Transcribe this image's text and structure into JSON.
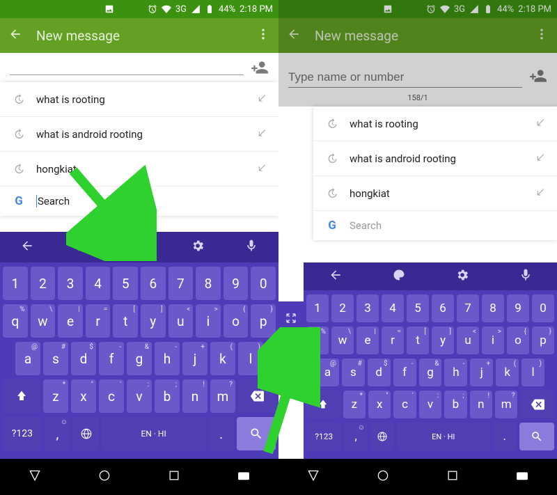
{
  "status": {
    "network": "3G",
    "battery": "44%",
    "time": "2:18 PM"
  },
  "appbar": {
    "title": "New message"
  },
  "recipient": {
    "placeholder": "Type name or number",
    "counter": "158/1"
  },
  "suggestions": [
    {
      "label": "what is rooting"
    },
    {
      "label": "what is android rooting"
    },
    {
      "label": "hongkiat"
    }
  ],
  "searchRow": {
    "label": "Search"
  },
  "keyboard": {
    "row1": [
      "1",
      "2",
      "3",
      "4",
      "5",
      "6",
      "7",
      "8",
      "9",
      "0"
    ],
    "row2": [
      {
        "k": "q",
        "s": "%"
      },
      {
        "k": "w",
        "s": "\\"
      },
      {
        "k": "e",
        "s": "|"
      },
      {
        "k": "r",
        "s": "="
      },
      {
        "k": "t",
        "s": "["
      },
      {
        "k": "y",
        "s": "]"
      },
      {
        "k": "u",
        "s": "<"
      },
      {
        "k": "i",
        "s": ">"
      },
      {
        "k": "o",
        "s": "{"
      },
      {
        "k": "p",
        "s": "}"
      }
    ],
    "row3": [
      {
        "k": "a",
        "s": "@"
      },
      {
        "k": "s",
        "s": "#"
      },
      {
        "k": "d",
        "s": "$"
      },
      {
        "k": "f",
        "s": "-"
      },
      {
        "k": "g",
        "s": "&"
      },
      {
        "k": "h",
        "s": "-"
      },
      {
        "k": "j",
        "s": "+"
      },
      {
        "k": "k",
        "s": "("
      },
      {
        "k": "l",
        "s": ")"
      }
    ],
    "row4": [
      {
        "k": "z",
        "s": "*"
      },
      {
        "k": "x",
        "s": "\""
      },
      {
        "k": "c",
        "s": "'"
      },
      {
        "k": "v",
        "s": ":"
      },
      {
        "k": "b",
        "s": ";"
      },
      {
        "k": "n",
        "s": "!"
      },
      {
        "k": "m",
        "s": "?"
      }
    ],
    "symKey": "?123",
    "spaceLabel": "EN · HI",
    "comma": ",",
    "period": "."
  }
}
